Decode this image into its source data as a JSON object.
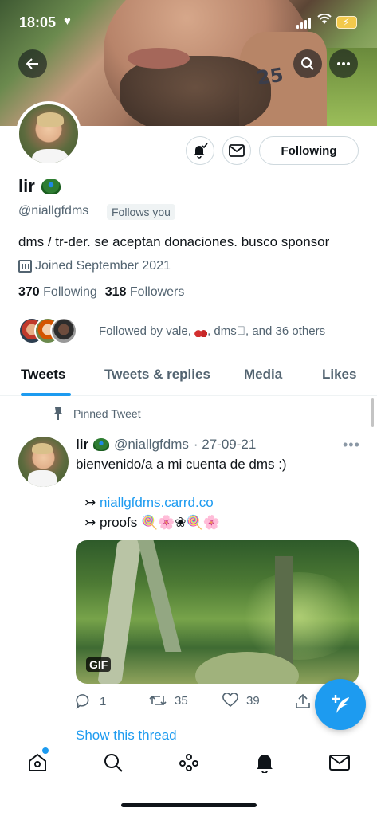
{
  "status_bar": {
    "time": "18:05"
  },
  "header": {
    "back_icon": "arrow-left-icon",
    "search_icon": "search-icon",
    "more_icon": "more-icon",
    "banner_tattoo": "25"
  },
  "profile": {
    "name": "lir",
    "handle": "@niallgfdms",
    "follows_you": "Follows you",
    "bio": "dms / tr-der. se aceptan donaciones. busco sponsor",
    "joined": "Joined September 2021",
    "following_count": "370",
    "following_label": "Following",
    "followers_count": "318",
    "followers_label": "Followers",
    "followed_by_prefix": "Followed by vale,",
    "followed_by_suffix": ", dms᳸, and 36 others"
  },
  "actions": {
    "following_button": "Following"
  },
  "tabs": [
    {
      "label": "Tweets",
      "active": true
    },
    {
      "label": "Tweets & replies",
      "active": false
    },
    {
      "label": "Media",
      "active": false
    },
    {
      "label": "Likes",
      "active": false
    }
  ],
  "tweet": {
    "pinned_label": "Pinned Tweet",
    "author_name": "lir",
    "author_handle": "@niallgfdms",
    "date": "· 27-09-21",
    "text": "bienvenido/a a mi cuenta de dms :)",
    "line1_prefix": "↣",
    "line1_link": "niallgfdms.carrd.co",
    "line2_prefix": "↣",
    "line2_text": "proofs 🍭🌸❀🍭🌸",
    "media_badge": "GIF",
    "reply_count": "1",
    "retweet_count": "35",
    "like_count": "39",
    "show_thread": "Show this thread"
  },
  "colors": {
    "accent": "#1d9bf0",
    "text_primary": "#0f1419",
    "text_secondary": "#536471",
    "border": "#cfd9de"
  }
}
